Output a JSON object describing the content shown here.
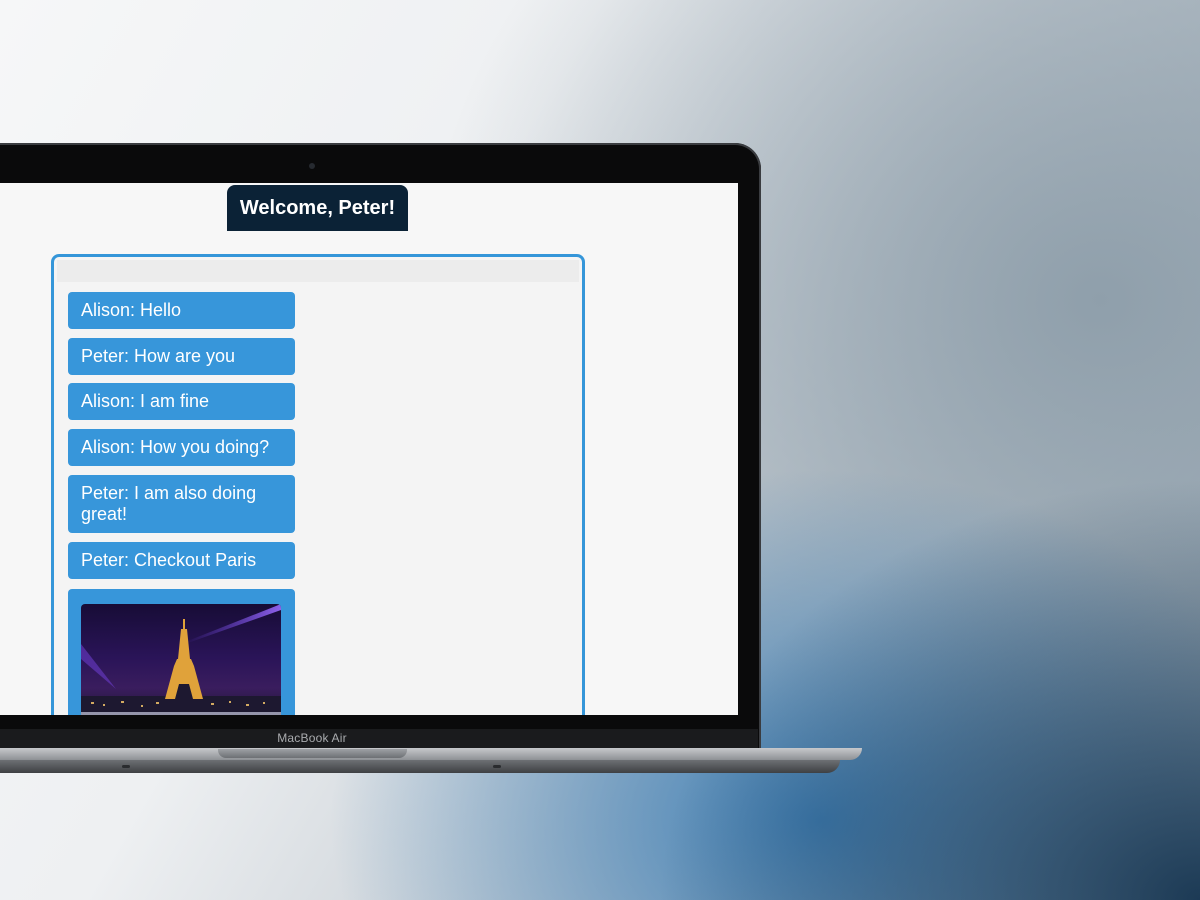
{
  "device": {
    "label": "MacBook Air"
  },
  "app": {
    "welcome": "Welcome, Peter!",
    "messages": [
      {
        "text": "Alison: Hello"
      },
      {
        "text": "Peter: How are you"
      },
      {
        "text": "Alison: I am fine"
      },
      {
        "text": "Alison: How you doing?"
      },
      {
        "text": "Peter: I am also doing great!"
      },
      {
        "text": "Peter: Checkout Paris"
      }
    ],
    "image_message": {
      "subject": "eiffel-tower-night-photo"
    }
  },
  "colors": {
    "accent": "#3796da",
    "welcome_bg": "#0b2236",
    "screen_bg": "#f7f7f7"
  }
}
